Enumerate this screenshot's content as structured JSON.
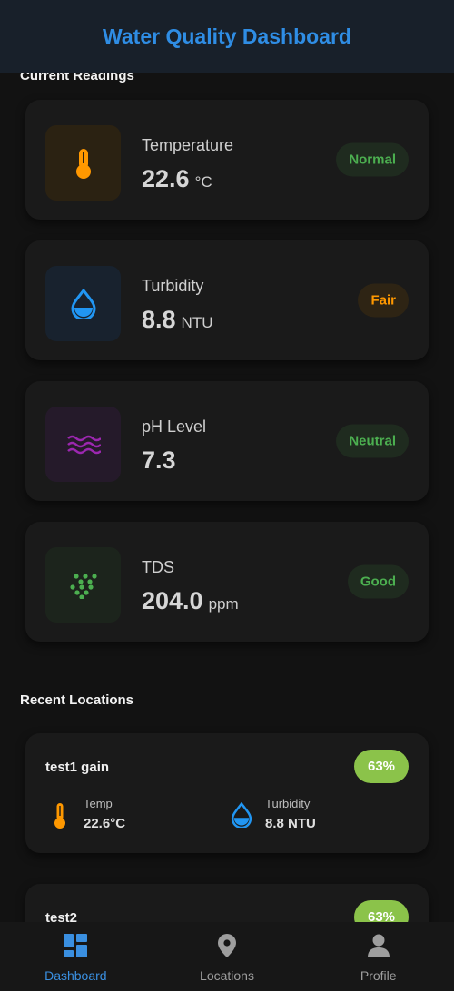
{
  "app": {
    "title": "Water Quality Dashboard"
  },
  "current_readings": {
    "title": "Current Readings",
    "items": [
      {
        "name": "Temperature",
        "value": "22.6",
        "unit": "°C",
        "status": "Normal",
        "icon": "thermometer-icon",
        "status_color": "#4caf50"
      },
      {
        "name": "Turbidity",
        "value": "8.8",
        "unit": "NTU",
        "status": "Fair",
        "icon": "water-drop-icon",
        "status_color": "#ff9800"
      },
      {
        "name": "pH Level",
        "value": "7.3",
        "unit": "",
        "status": "Neutral",
        "icon": "waves-icon",
        "status_color": "#4caf50"
      },
      {
        "name": "TDS",
        "value": "204.0",
        "unit": "ppm",
        "status": "Good",
        "icon": "dots-icon",
        "status_color": "#4caf50"
      }
    ]
  },
  "recent_locations": {
    "title": "Recent Locations",
    "items": [
      {
        "name": "test1 gain",
        "score": "63%",
        "temp_label": "Temp",
        "temp_value": "22.6°C",
        "turbidity_label": "Turbidity",
        "turbidity_value": "8.8 NTU"
      },
      {
        "name": "test2",
        "score": "63%"
      }
    ]
  },
  "nav": {
    "items": [
      {
        "label": "Dashboard",
        "icon": "dashboard-icon",
        "active": true
      },
      {
        "label": "Locations",
        "icon": "location-pin-icon",
        "active": false
      },
      {
        "label": "Profile",
        "icon": "person-icon",
        "active": false
      }
    ]
  },
  "colors": {
    "accent": "#2f8de4",
    "orange": "#ff9800",
    "blue": "#2196f3",
    "purple": "#9c27b0",
    "green": "#4caf50",
    "score": "#8bc34a"
  }
}
